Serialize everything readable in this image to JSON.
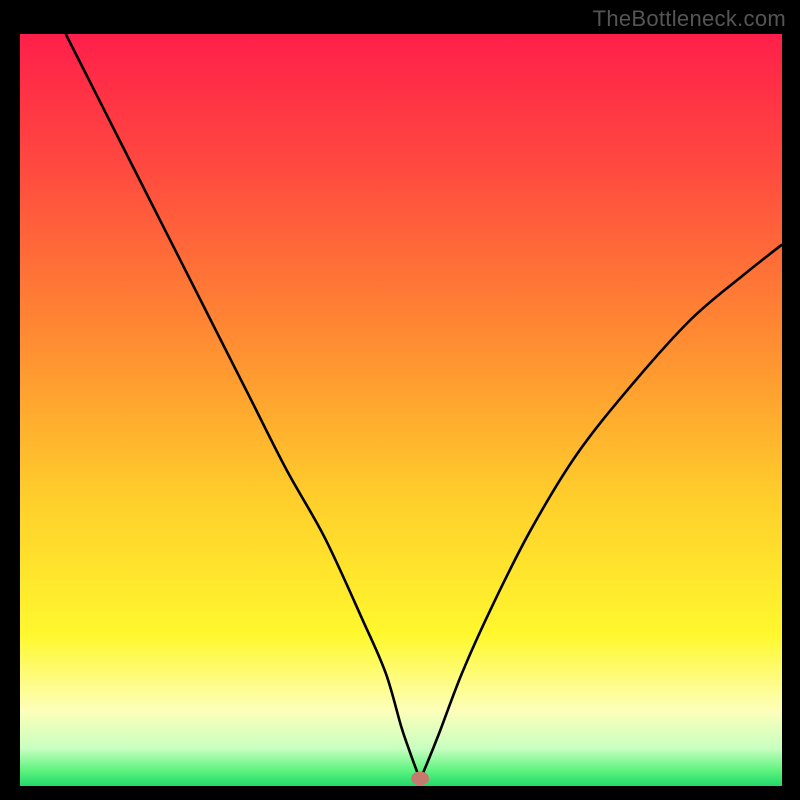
{
  "watermark": "TheBottleneck.com",
  "chart_data": {
    "type": "line",
    "title": "",
    "xlabel": "",
    "ylabel": "",
    "xlim": [
      0,
      100
    ],
    "ylim": [
      0,
      100
    ],
    "grid": false,
    "legend": false,
    "background": "rainbow-vertical",
    "marker": {
      "x": 52.5,
      "y": 1.0,
      "color": "#c47a6f"
    },
    "series": [
      {
        "name": "curve",
        "x": [
          6,
          10,
          15,
          20,
          25,
          30,
          35,
          40,
          45,
          48,
          50,
          51,
          52,
          52.5,
          53,
          55,
          58,
          62,
          67,
          73,
          80,
          88,
          95,
          100
        ],
        "y": [
          100,
          92,
          82,
          72,
          62,
          52,
          42,
          33,
          22,
          15,
          8,
          5,
          2.2,
          1.0,
          2.0,
          7,
          15,
          24,
          34,
          44,
          53,
          62,
          68,
          72
        ]
      }
    ],
    "gradient_stops": [
      {
        "offset": 0,
        "color": "#ff1f4a"
      },
      {
        "offset": 18,
        "color": "#ff4a3f"
      },
      {
        "offset": 40,
        "color": "#ff8a32"
      },
      {
        "offset": 62,
        "color": "#ffcf2b"
      },
      {
        "offset": 80,
        "color": "#fff82e"
      },
      {
        "offset": 90,
        "color": "#fdffba"
      },
      {
        "offset": 95,
        "color": "#c8ffc0"
      },
      {
        "offset": 98,
        "color": "#5cf27e"
      },
      {
        "offset": 100,
        "color": "#21d96b"
      }
    ]
  }
}
